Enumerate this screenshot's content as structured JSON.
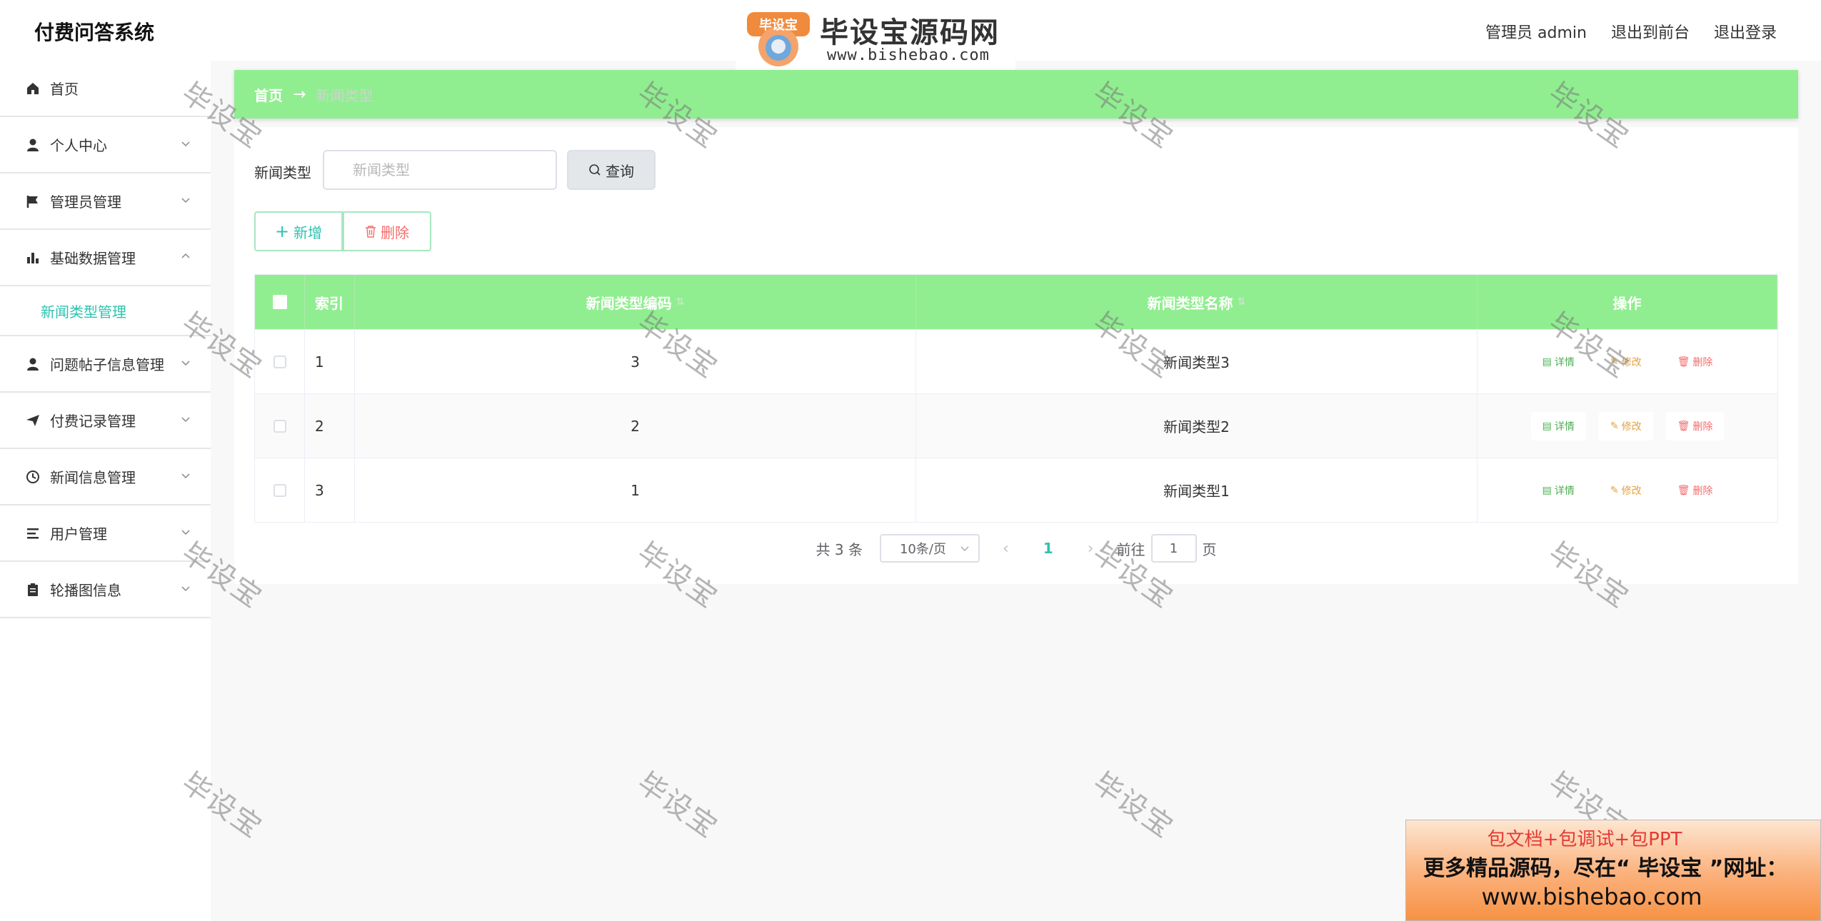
{
  "header": {
    "app_title": "付费问答系统",
    "admin_label": "管理员 admin",
    "to_front": "退出到前台",
    "logout": "退出登录"
  },
  "logo": {
    "badge": "毕设宝",
    "name": "毕设宝源码网",
    "url": "www.bishebao.com"
  },
  "sidebar": {
    "items": [
      {
        "label": "首页",
        "icon": "home-icon",
        "has_chevron": false
      },
      {
        "label": "个人中心",
        "icon": "user-icon",
        "has_chevron": true
      },
      {
        "label": "管理员管理",
        "icon": "flag-icon",
        "has_chevron": true
      },
      {
        "label": "基础数据管理",
        "icon": "chart-icon",
        "has_chevron": true,
        "expanded": true
      },
      {
        "label": "问题帖子信息管理",
        "icon": "user-icon",
        "has_chevron": true
      },
      {
        "label": "付费记录管理",
        "icon": "send-icon",
        "has_chevron": true
      },
      {
        "label": "新闻信息管理",
        "icon": "clock-icon",
        "has_chevron": true
      },
      {
        "label": "用户管理",
        "icon": "list-icon",
        "has_chevron": true
      },
      {
        "label": "轮播图信息",
        "icon": "clipboard-icon",
        "has_chevron": true
      }
    ],
    "submenu": {
      "label": "新闻类型管理"
    }
  },
  "breadcrumb": {
    "home": "首页",
    "arrow": "→",
    "current": "新闻类型"
  },
  "filter": {
    "label": "新闻类型",
    "placeholder": "新闻类型",
    "query_button": "查询"
  },
  "actions": {
    "add": "新增",
    "delete": "删除"
  },
  "table": {
    "columns": {
      "index": "索引",
      "code": "新闻类型编码",
      "name": "新闻类型名称",
      "ops": "操作"
    },
    "rows": [
      {
        "index": "1",
        "code": "3",
        "name": "新闻类型3"
      },
      {
        "index": "2",
        "code": "2",
        "name": "新闻类型2"
      },
      {
        "index": "3",
        "code": "1",
        "name": "新闻类型1"
      }
    ],
    "op_labels": {
      "detail": "详情",
      "edit": "修改",
      "delete": "删除"
    }
  },
  "pagination": {
    "total": "共 3 条",
    "page_size": "10条/页",
    "current_page": "1",
    "goto_prefix": "前往",
    "goto_value": "1",
    "goto_suffix": "页"
  },
  "watermark": "毕设宝",
  "ad": {
    "line1": "包文档+包调试+包PPT",
    "line2": "更多精品源码，尽在“ 毕设宝 ”网址：",
    "line3": "www.bishebao.com"
  },
  "colors": {
    "accent_green": "#90ee90",
    "teal": "#2dc3b0",
    "danger": "#f56c6c",
    "warning": "#e6a23c"
  }
}
